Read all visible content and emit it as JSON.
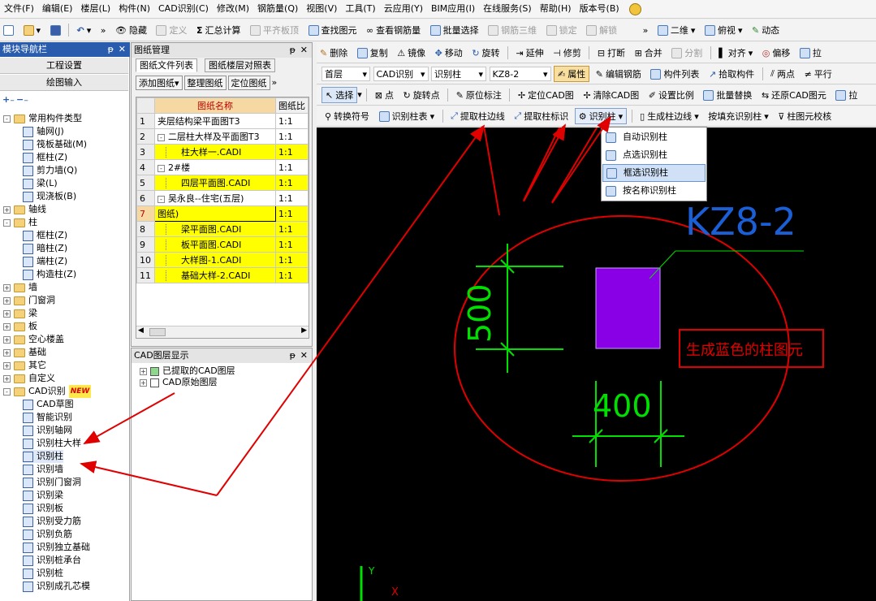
{
  "menu": [
    "文件(F)",
    "编辑(E)",
    "楼层(L)",
    "构件(N)",
    "CAD识别(C)",
    "修改(M)",
    "钢筋量(Q)",
    "视图(V)",
    "工具(T)",
    "云应用(Y)",
    "BIM应用(I)",
    "在线服务(S)",
    "帮助(H)",
    "版本号(B)"
  ],
  "toolbar1": {
    "hide": "隐藏",
    "define": "定义",
    "summary": "汇总计算",
    "flat": "平齐板顶",
    "find": "查找图元",
    "view_rebar": "查看钢筋量",
    "batch": "批量选择",
    "rebar3d": "钢筋三维",
    "lock": "锁定",
    "unlock": "解锁",
    "view2d": "二维",
    "view_top": "俯视",
    "dynamic": "动态"
  },
  "toolbar2": {
    "delete": "删除",
    "copy": "复制",
    "mirror": "镜像",
    "move": "移动",
    "rotate": "旋转",
    "extend": "延伸",
    "trim": "修剪",
    "break": "打断",
    "merge": "合并",
    "split": "分割",
    "align": "对齐",
    "offset": "偏移",
    "pull": "拉"
  },
  "toolbar3": {
    "floor": "首层",
    "cad": "CAD识别",
    "type": "识别柱",
    "name": "KZ8-2",
    "attr": "属性",
    "edit_rebar": "编辑钢筋",
    "list": "构件列表",
    "pick": "拾取构件",
    "twopoint": "两点",
    "parallel": "平行"
  },
  "toolbar4": {
    "select": "选择",
    "point": "点",
    "rotpoint": "旋转点",
    "origin": "原位标注",
    "locate_cad": "定位CAD图",
    "clear_cad": "清除CAD图",
    "set_scale": "设置比例",
    "batch_replace": "批量替换",
    "restore_cad": "还原CAD图元",
    "pull": "拉"
  },
  "toolbar5": {
    "convert": "转换符号",
    "ident_table": "识别柱表",
    "extract_edge": "提取柱边线",
    "extract_label": "提取柱标识",
    "ident_col": "识别柱",
    "gen_edge": "生成柱边线",
    "fill_ident": "按填充识别柱",
    "check": "柱图元校核"
  },
  "nav": {
    "title": "模块导航栏",
    "btn_settings": "工程设置",
    "btn_input": "绘图输入",
    "tree": [
      {
        "label": "常用构件类型",
        "level": 0,
        "exp": "-",
        "type": "folder"
      },
      {
        "label": "轴网(J)",
        "level": 1,
        "type": "node"
      },
      {
        "label": "筏板基础(M)",
        "level": 1,
        "type": "node"
      },
      {
        "label": "框柱(Z)",
        "level": 1,
        "type": "node"
      },
      {
        "label": "剪力墙(Q)",
        "level": 1,
        "type": "node"
      },
      {
        "label": "梁(L)",
        "level": 1,
        "type": "node"
      },
      {
        "label": "现浇板(B)",
        "level": 1,
        "type": "node"
      },
      {
        "label": "轴线",
        "level": 0,
        "exp": "+",
        "type": "folder"
      },
      {
        "label": "柱",
        "level": 0,
        "exp": "-",
        "type": "folder"
      },
      {
        "label": "框柱(Z)",
        "level": 1,
        "type": "node"
      },
      {
        "label": "暗柱(Z)",
        "level": 1,
        "type": "node"
      },
      {
        "label": "端柱(Z)",
        "level": 1,
        "type": "node"
      },
      {
        "label": "构造柱(Z)",
        "level": 1,
        "type": "node"
      },
      {
        "label": "墙",
        "level": 0,
        "exp": "+",
        "type": "folder"
      },
      {
        "label": "门窗洞",
        "level": 0,
        "exp": "+",
        "type": "folder"
      },
      {
        "label": "梁",
        "level": 0,
        "exp": "+",
        "type": "folder"
      },
      {
        "label": "板",
        "level": 0,
        "exp": "+",
        "type": "folder"
      },
      {
        "label": "空心楼盖",
        "level": 0,
        "exp": "+",
        "type": "folder"
      },
      {
        "label": "基础",
        "level": 0,
        "exp": "+",
        "type": "folder"
      },
      {
        "label": "其它",
        "level": 0,
        "exp": "+",
        "type": "folder"
      },
      {
        "label": "自定义",
        "level": 0,
        "exp": "+",
        "type": "folder"
      },
      {
        "label": "CAD识别",
        "level": 0,
        "exp": "-",
        "type": "folder",
        "badge": "NEW"
      },
      {
        "label": "CAD草图",
        "level": 1,
        "type": "node"
      },
      {
        "label": "智能识别",
        "level": 1,
        "type": "node"
      },
      {
        "label": "识别轴网",
        "level": 1,
        "type": "node"
      },
      {
        "label": "识别柱大样",
        "level": 1,
        "type": "node"
      },
      {
        "label": "识别柱",
        "level": 1,
        "type": "node",
        "sel": true
      },
      {
        "label": "识别墙",
        "level": 1,
        "type": "node"
      },
      {
        "label": "识别门窗洞",
        "level": 1,
        "type": "node"
      },
      {
        "label": "识别梁",
        "level": 1,
        "type": "node"
      },
      {
        "label": "识别板",
        "level": 1,
        "type": "node"
      },
      {
        "label": "识别受力筋",
        "level": 1,
        "type": "node"
      },
      {
        "label": "识别负筋",
        "level": 1,
        "type": "node"
      },
      {
        "label": "识别独立基础",
        "level": 1,
        "type": "node"
      },
      {
        "label": "识别桩承台",
        "level": 1,
        "type": "node"
      },
      {
        "label": "识别桩",
        "level": 1,
        "type": "node"
      },
      {
        "label": "识别成孔芯模",
        "level": 1,
        "type": "node"
      }
    ]
  },
  "drawings": {
    "title": "图纸管理",
    "tab1": "图纸文件列表",
    "tab2": "图纸楼层对照表",
    "btn_add": "添加图纸",
    "btn_arrange": "整理图纸",
    "btn_locate": "定位图纸",
    "col_name": "图纸名称",
    "col_scale": "图纸比",
    "rows": [
      {
        "n": "1",
        "name": "夹层结构梁平面图T3",
        "scale": "1:1",
        "hl": false,
        "exp": "",
        "indent": 0
      },
      {
        "n": "2",
        "name": "二层柱大样及平面图T3",
        "scale": "1:1",
        "hl": false,
        "exp": "-",
        "indent": 0
      },
      {
        "n": "3",
        "name": "柱大样一.CADI",
        "scale": "1:1",
        "hl": true,
        "exp": "",
        "indent": 2
      },
      {
        "n": "4",
        "name": "2#楼",
        "scale": "1:1",
        "hl": false,
        "exp": "-",
        "indent": 0
      },
      {
        "n": "5",
        "name": "四层平面图.CADI",
        "scale": "1:1",
        "hl": true,
        "exp": "",
        "indent": 2
      },
      {
        "n": "6",
        "name": "吴永良--住宅(五层)",
        "scale": "1:1",
        "hl": false,
        "exp": "-",
        "indent": 0
      },
      {
        "n": "7",
        "name": "图纸)",
        "scale": "1:1",
        "hl": true,
        "exp": "",
        "indent": 0,
        "edit": true
      },
      {
        "n": "8",
        "name": "梁平面图.CADI",
        "scale": "1:1",
        "hl": true,
        "exp": "",
        "indent": 2
      },
      {
        "n": "9",
        "name": "板平面图.CADI",
        "scale": "1:1",
        "hl": true,
        "exp": "",
        "indent": 2
      },
      {
        "n": "10",
        "name": "大样图-1.CADI",
        "scale": "1:1",
        "hl": true,
        "exp": "",
        "indent": 2
      },
      {
        "n": "11",
        "name": "基础大样-2.CADI",
        "scale": "1:1",
        "hl": true,
        "exp": "",
        "indent": 2
      }
    ]
  },
  "layers": {
    "title": "CAD图层显示",
    "items": [
      {
        "label": "已提取的CAD图层",
        "checked": true
      },
      {
        "label": "CAD原始图层",
        "checked": false
      }
    ]
  },
  "dropdown": [
    "自动识别柱",
    "点选识别柱",
    "框选识别柱",
    "按名称识别柱"
  ],
  "dropdown_selected": 2,
  "canvas": {
    "label_name": "KZ8-2",
    "dim_vertical": "500",
    "dim_horizontal": "400",
    "note": "生成蓝色的柱图元",
    "axis_y": "Y",
    "axis_x": "X",
    "colors": {
      "bg": "#000000",
      "column": "#8a00e6",
      "dim": "#00e000",
      "label": "#1a5fd6",
      "annot": "#e00000"
    }
  }
}
